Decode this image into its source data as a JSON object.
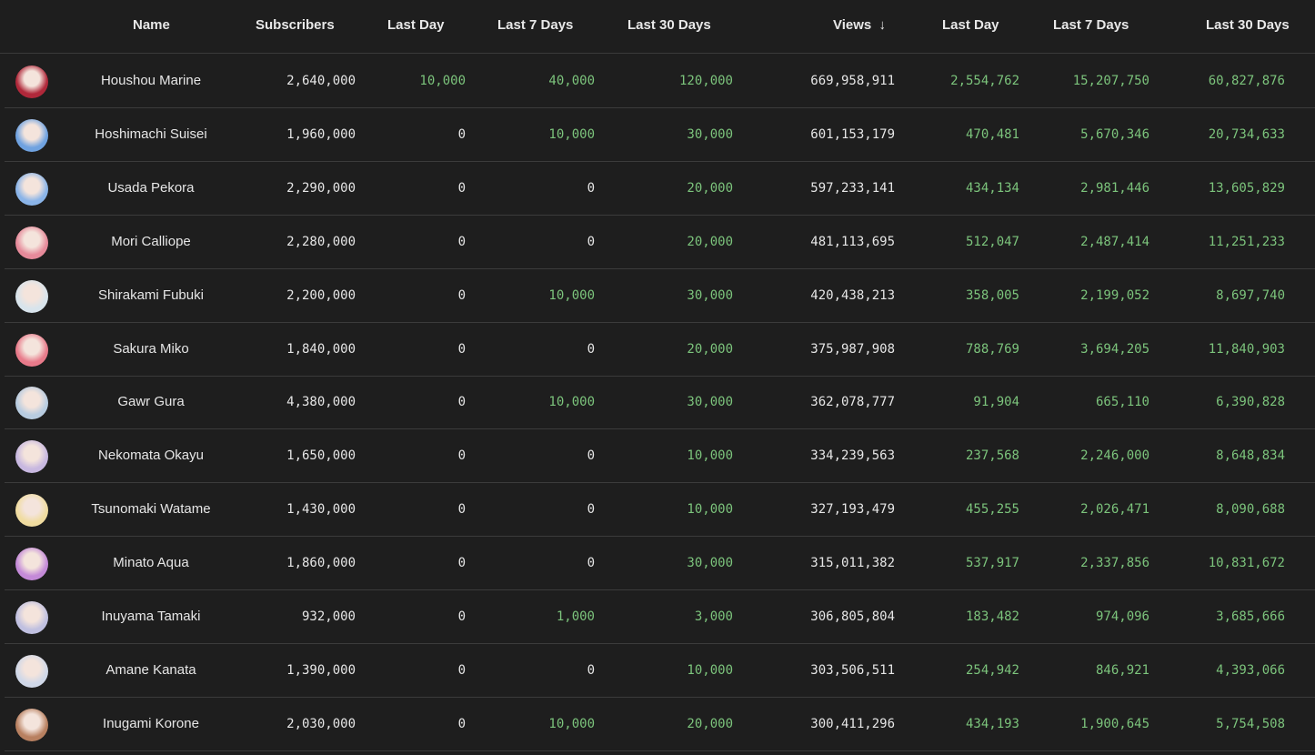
{
  "header": {
    "columns": [
      "Name",
      "Subscribers",
      "Last Day",
      "Last 7 Days",
      "Last 30 Days",
      "Views",
      "Last Day",
      "Last 7 Days",
      "Last 30 Days"
    ],
    "sort_icon": "arrow-down-icon",
    "sort_glyph": "↓"
  },
  "colors": {
    "positive": "#7cc47c",
    "text": "#e6e6e6",
    "background": "#1e1e1e"
  },
  "rows": [
    {
      "name": "Houshou Marine",
      "subs": "2,640,000",
      "sd": "10,000",
      "s7": "40,000",
      "s30": "120,000",
      "views": "669,958,911",
      "vd": "2,554,762",
      "v7": "15,207,750",
      "v30": "60,827,876",
      "avatar": "#b0283a"
    },
    {
      "name": "Hoshimachi Suisei",
      "subs": "1,960,000",
      "sd": "0",
      "s7": "10,000",
      "s30": "30,000",
      "views": "601,153,179",
      "vd": "470,481",
      "v7": "5,670,346",
      "v30": "20,734,633",
      "avatar": "#6fa2e0"
    },
    {
      "name": "Usada Pekora",
      "subs": "2,290,000",
      "sd": "0",
      "s7": "0",
      "s30": "20,000",
      "views": "597,233,141",
      "vd": "434,134",
      "v7": "2,981,446",
      "v30": "13,605,829",
      "avatar": "#8ab4e8"
    },
    {
      "name": "Mori Calliope",
      "subs": "2,280,000",
      "sd": "0",
      "s7": "0",
      "s30": "20,000",
      "views": "481,113,695",
      "vd": "512,047",
      "v7": "2,487,414",
      "v30": "11,251,233",
      "avatar": "#e68a9a"
    },
    {
      "name": "Shirakami Fubuki",
      "subs": "2,200,000",
      "sd": "0",
      "s7": "10,000",
      "s30": "30,000",
      "views": "420,438,213",
      "vd": "358,005",
      "v7": "2,199,052",
      "v30": "8,697,740",
      "avatar": "#d8e4ec"
    },
    {
      "name": "Sakura Miko",
      "subs": "1,840,000",
      "sd": "0",
      "s7": "0",
      "s30": "20,000",
      "views": "375,987,908",
      "vd": "788,769",
      "v7": "3,694,205",
      "v30": "11,840,903",
      "avatar": "#e87a8a"
    },
    {
      "name": "Gawr Gura",
      "subs": "4,380,000",
      "sd": "0",
      "s7": "10,000",
      "s30": "30,000",
      "views": "362,078,777",
      "vd": "91,904",
      "v7": "665,110",
      "v30": "6,390,828",
      "avatar": "#b8cce0"
    },
    {
      "name": "Nekomata Okayu",
      "subs": "1,650,000",
      "sd": "0",
      "s7": "0",
      "s30": "10,000",
      "views": "334,239,563",
      "vd": "237,568",
      "v7": "2,246,000",
      "v30": "8,648,834",
      "avatar": "#c8b8e0"
    },
    {
      "name": "Tsunomaki Watame",
      "subs": "1,430,000",
      "sd": "0",
      "s7": "0",
      "s30": "10,000",
      "views": "327,193,479",
      "vd": "455,255",
      "v7": "2,026,471",
      "v30": "8,090,688",
      "avatar": "#f0dca0"
    },
    {
      "name": "Minato Aqua",
      "subs": "1,860,000",
      "sd": "0",
      "s7": "0",
      "s30": "30,000",
      "views": "315,011,382",
      "vd": "537,917",
      "v7": "2,337,856",
      "v30": "10,831,672",
      "avatar": "#c48ad8"
    },
    {
      "name": "Inuyama Tamaki",
      "subs": "932,000",
      "sd": "0",
      "s7": "1,000",
      "s30": "3,000",
      "views": "306,805,804",
      "vd": "183,482",
      "v7": "974,096",
      "v30": "3,685,666",
      "avatar": "#c0c0e0"
    },
    {
      "name": "Amane Kanata",
      "subs": "1,390,000",
      "sd": "0",
      "s7": "0",
      "s30": "10,000",
      "views": "303,506,511",
      "vd": "254,942",
      "v7": "846,921",
      "v30": "4,393,066",
      "avatar": "#d0d8e8"
    },
    {
      "name": "Inugami Korone",
      "subs": "2,030,000",
      "sd": "0",
      "s7": "10,000",
      "s30": "20,000",
      "views": "300,411,296",
      "vd": "434,193",
      "v7": "1,900,645",
      "v30": "5,754,508",
      "avatar": "#b88060"
    }
  ]
}
